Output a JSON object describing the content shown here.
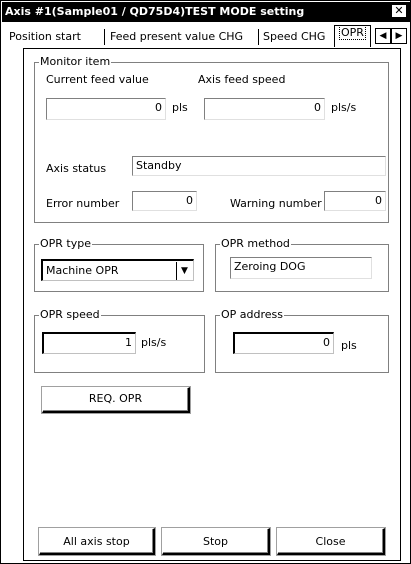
{
  "window": {
    "title": "Axis #1(Sample01 / QD75D4)TEST MODE setting",
    "close_glyph": "✕"
  },
  "tabs": [
    {
      "label": "Position start"
    },
    {
      "label": "Feed present value CHG"
    },
    {
      "label": "Speed CHG"
    },
    {
      "label": "OPR",
      "active": true
    }
  ],
  "tab_scroll": {
    "left": "◀",
    "right": "▶"
  },
  "monitor": {
    "title": "Monitor item",
    "current_feed_label": "Current feed value",
    "current_feed_value": "0",
    "current_feed_unit": "pls",
    "axis_speed_label": "Axis feed speed",
    "axis_speed_value": "0",
    "axis_speed_unit": "pls/s",
    "axis_status_label": "Axis status",
    "axis_status_value": "Standby",
    "error_label": "Error number",
    "error_value": "0",
    "warning_label": "Warning number",
    "warning_value": "0"
  },
  "opr_type": {
    "title": "OPR type",
    "selected": "Machine OPR"
  },
  "opr_method": {
    "title": "OPR method",
    "value": "Zeroing DOG"
  },
  "opr_speed": {
    "title": "OPR speed",
    "value": "1",
    "unit": "pls/s"
  },
  "op_address": {
    "title": "OP address",
    "value": "0",
    "unit": "pls"
  },
  "buttons": {
    "req_opr": "REQ. OPR",
    "all_axis_stop": "All axis stop",
    "stop": "Stop",
    "close": "Close"
  }
}
